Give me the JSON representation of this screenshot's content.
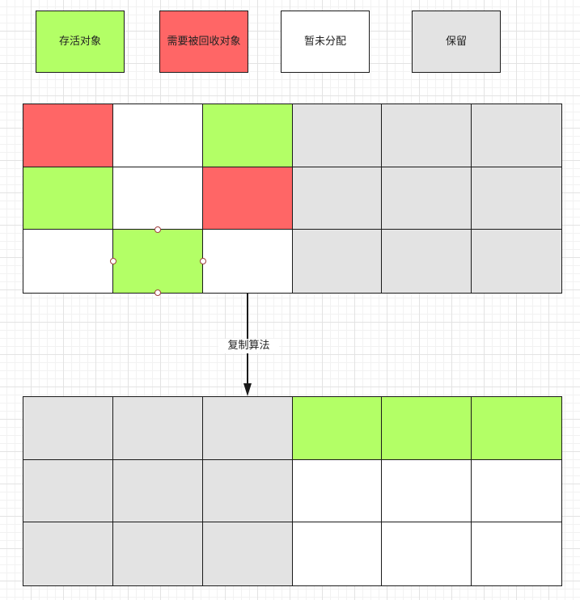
{
  "legend": {
    "live": "存活对象",
    "recycle": "需要被回收对象",
    "free": "暂未分配",
    "reserved": "保留"
  },
  "colors": {
    "live": "#b3ff66",
    "recycle": "#ff6666",
    "free": "#ffffff",
    "reserved": "#e3e3e3",
    "border": "#1a1a1a"
  },
  "grid_before": [
    [
      "recycle",
      "free",
      "live",
      "reserved",
      "reserved",
      "reserved"
    ],
    [
      "live",
      "free",
      "recycle",
      "reserved",
      "reserved",
      "reserved"
    ],
    [
      "free",
      "live",
      "free",
      "reserved",
      "reserved",
      "reserved"
    ]
  ],
  "arrow_label": "复制算法",
  "grid_after": [
    [
      "reserved",
      "reserved",
      "reserved",
      "live",
      "live",
      "live"
    ],
    [
      "reserved",
      "reserved",
      "reserved",
      "free",
      "free",
      "free"
    ],
    [
      "reserved",
      "reserved",
      "reserved",
      "free",
      "free",
      "free"
    ]
  ]
}
